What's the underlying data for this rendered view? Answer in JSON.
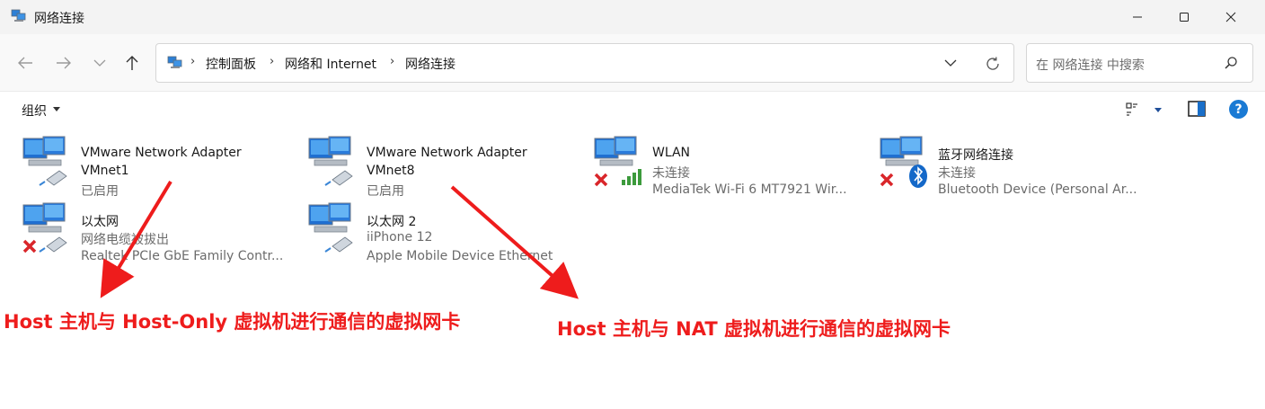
{
  "window": {
    "title": "网络连接",
    "minimize_glyph": "—",
    "close_glyph": "✕"
  },
  "address": {
    "crumbs": [
      "控制面板",
      "网络和 Internet",
      "网络连接"
    ],
    "search_placeholder": "在 网络连接 中搜索"
  },
  "toolbar": {
    "organize_label": "组织",
    "help_label": "?"
  },
  "connections": [
    {
      "name": "VMware Network Adapter",
      "line2": "VMnet1",
      "line3": "已启用",
      "status": "enabled"
    },
    {
      "name": "VMware Network Adapter",
      "line2": "VMnet8",
      "line3": "已启用",
      "status": "enabled"
    },
    {
      "name": "WLAN",
      "line2": "未连接",
      "line3": "MediaTek Wi-Fi 6 MT7921 Wir...",
      "status": "disconnected"
    },
    {
      "name": "蓝牙网络连接",
      "line2": "未连接",
      "line3": "Bluetooth Device (Personal Ar...",
      "status": "disconnected"
    },
    {
      "name": "以太网",
      "line2": "网络电缆被拔出",
      "line3": "Realtek PCIe GbE Family Contr...",
      "status": "unplugged"
    },
    {
      "name": "以太网 2",
      "line2": "iiPhone 12",
      "line3": "Apple Mobile Device Ethernet",
      "status": "enabled"
    }
  ],
  "annotations": {
    "host_only": "Host 主机与 Host-Only 虚拟机进行通信的虚拟网卡",
    "nat": "Host 主机与 NAT 虚拟机进行通信的虚拟网卡",
    "color": "#ee1c1c"
  },
  "colors": {
    "accent": "#1a7ad4",
    "error_x": "#d9262a",
    "signal_green": "#3c9a3c"
  }
}
